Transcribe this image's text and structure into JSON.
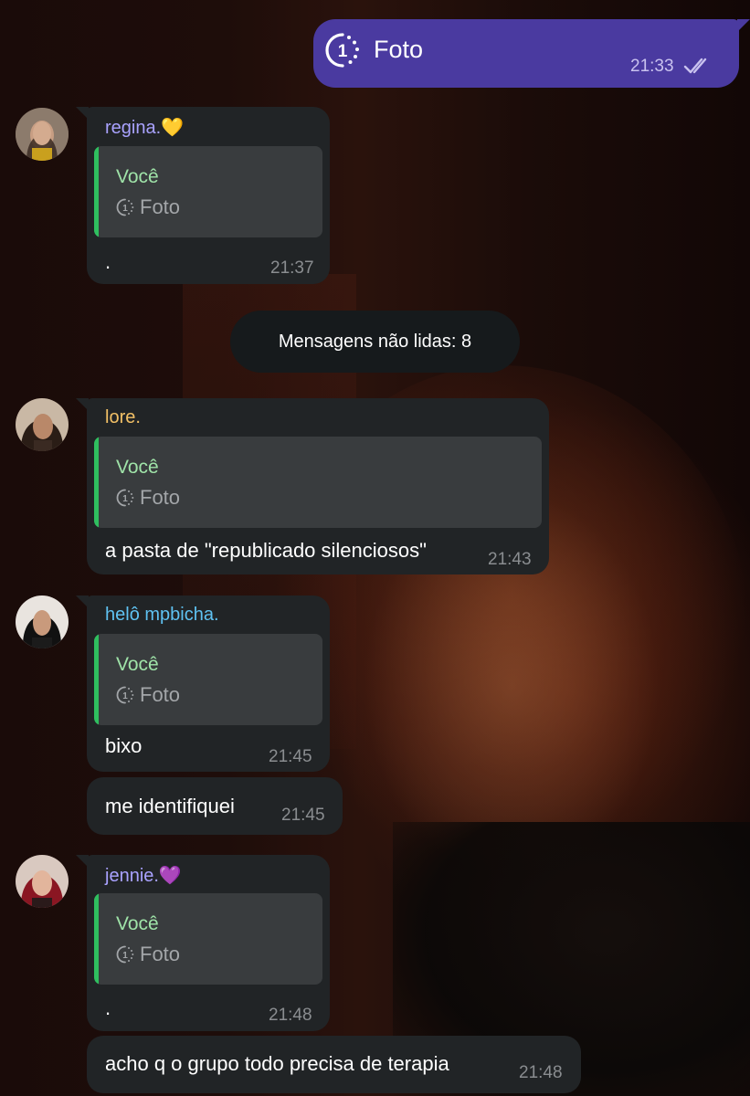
{
  "outgoing": {
    "text": "Foto",
    "time": "21:33",
    "icon": "view-once-icon",
    "status_icon": "double-check-icon"
  },
  "unread": {
    "label": "Mensagens não lidas: 8"
  },
  "messages": [
    {
      "sender": "regina.💛",
      "sender_color": "#a9a2ff",
      "reply": {
        "name": "Você",
        "content": "Foto"
      },
      "text": ".",
      "time": "21:37"
    },
    {
      "sender": "lore.",
      "sender_color": "#f2c066",
      "reply": {
        "name": "Você",
        "content": "Foto"
      },
      "text": "a pasta de \"republicado silenciosos\"",
      "time": "21:43"
    },
    {
      "sender": "helô mpbicha.",
      "sender_color": "#5fc2f2",
      "reply": {
        "name": "Você",
        "content": "Foto"
      },
      "text": "bixo",
      "time": "21:45"
    },
    {
      "text": "me identifiquei",
      "time": "21:45"
    },
    {
      "sender": "jennie.💜",
      "sender_color": "#a9a2ff",
      "reply": {
        "name": "Você",
        "content": "Foto"
      },
      "text": ".",
      "time": "21:48"
    },
    {
      "text": "acho q o grupo todo precisa de terapia",
      "time": "21:48"
    }
  ],
  "colors": {
    "bubble_in": "#212426",
    "bubble_out": "#4a3aa0",
    "reply_accent": "#2fbf5f",
    "reply_name": "#9fe3a8"
  }
}
